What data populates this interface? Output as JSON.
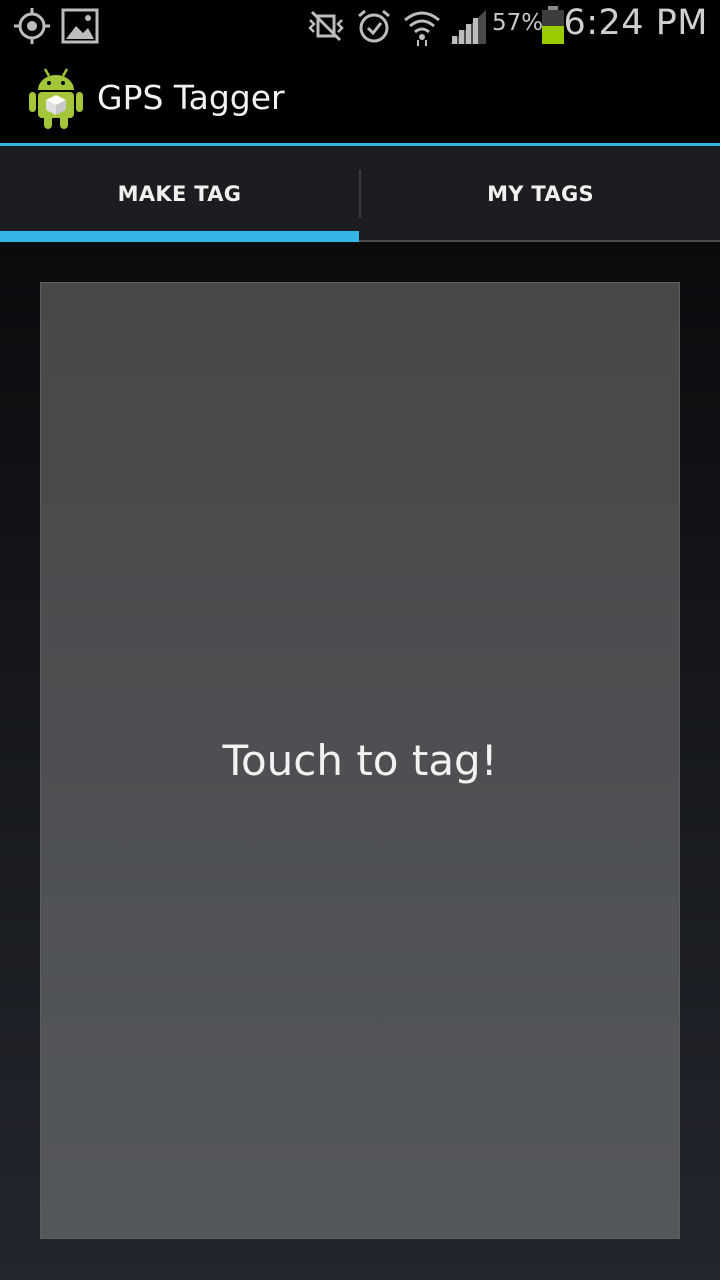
{
  "status_bar": {
    "icons": [
      "gps-icon",
      "gallery-icon",
      "mute-icon",
      "alarm-icon",
      "wifi-icon",
      "signal-icon",
      "battery-icon"
    ],
    "battery_percent": "57%",
    "time": "6:24 PM"
  },
  "action_bar": {
    "app_icon": "android-icon",
    "title": "GPS Tagger",
    "accent_color": "#33b5e5"
  },
  "tabs": [
    {
      "label": "MAKE TAG",
      "selected": true
    },
    {
      "label": "MY TAGS",
      "selected": false
    }
  ],
  "main": {
    "tag_prompt": "Touch to tag!"
  }
}
